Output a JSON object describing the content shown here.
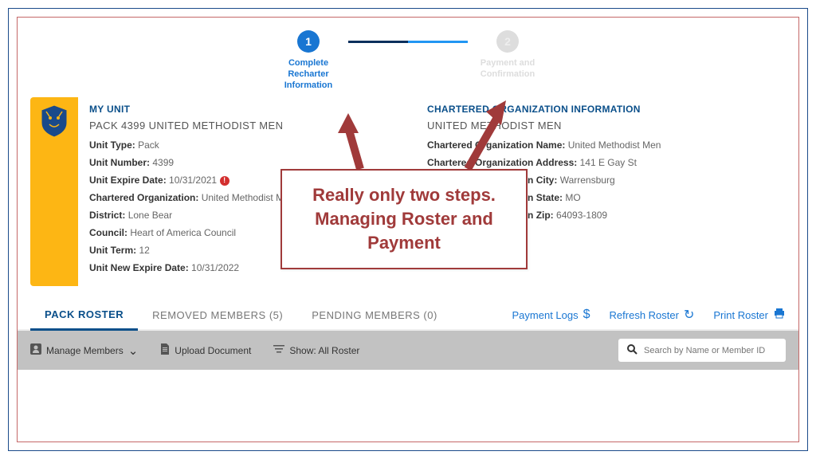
{
  "stepper": {
    "step1": {
      "num": "1",
      "label": "Complete\nRecharter\nInformation"
    },
    "step2": {
      "num": "2",
      "label": "Payment and\nConfirmation"
    }
  },
  "unit": {
    "title": "MY UNIT",
    "subtitle": "PACK 4399 UNITED METHODIST MEN",
    "fields": {
      "unitTypeLabel": "Unit Type:",
      "unitType": "Pack",
      "unitNumberLabel": "Unit Number:",
      "unitNumber": "4399",
      "unitExpireLabel": "Unit Expire Date:",
      "unitExpire": "10/31/2021",
      "charteredOrgLabel": "Chartered Organization:",
      "charteredOrg": "United Methodist Men",
      "districtLabel": "District:",
      "district": "Lone Bear",
      "councilLabel": "Council:",
      "council": "Heart of America Council",
      "unitTermLabel": "Unit Term:",
      "unitTerm": "12",
      "unitNewExpireLabel": "Unit New Expire Date:",
      "unitNewExpire": "10/31/2022"
    }
  },
  "org": {
    "title": "CHARTERED ORGANIZATION INFORMATION",
    "subtitle": "UNITED METHODIST MEN",
    "fields": {
      "nameLabel": "Chartered Organization Name:",
      "name": "United Methodist Men",
      "addrLabel": "Chartered Organization Address:",
      "addr": "141 E Gay St",
      "cityLabel": "Chartered Organization City:",
      "city": "Warrensburg",
      "stateLabel": "Chartered Organization State:",
      "state": "MO",
      "zipLabel": "Chartered Organization Zip:",
      "zip": "64093-1809"
    }
  },
  "tabs": {
    "packRoster": "PACK ROSTER",
    "removed": "REMOVED MEMBERS (5)",
    "pending": "PENDING MEMBERS (0)"
  },
  "actions": {
    "paymentLogs": "Payment Logs",
    "refreshRoster": "Refresh Roster",
    "printRoster": "Print Roster"
  },
  "toolbar": {
    "manageMembers": "Manage Members",
    "uploadDocument": "Upload Document",
    "showAll": "Show: All Roster",
    "searchPlaceholder": "Search by Name or Member ID"
  },
  "callout": {
    "line1": "Really only two steps.",
    "line2": "Managing Roster and",
    "line3": "Payment"
  }
}
